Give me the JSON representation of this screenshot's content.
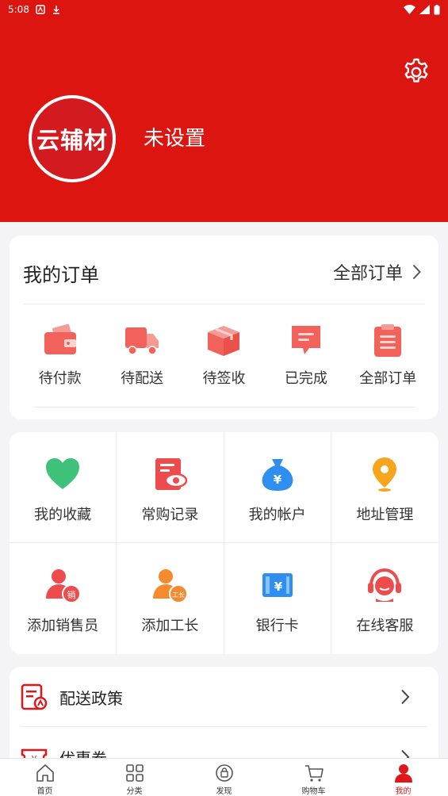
{
  "status_bar": {
    "time": "5:08"
  },
  "profile": {
    "avatar_text": "云辅材",
    "username": "未设置"
  },
  "orders": {
    "title": "我的订单",
    "all_label": "全部订单",
    "items": [
      {
        "label": "待付款",
        "icon": "wallet-icon"
      },
      {
        "label": "待配送",
        "icon": "truck-icon"
      },
      {
        "label": "待签收",
        "icon": "package-icon"
      },
      {
        "label": "已完成",
        "icon": "message-icon"
      },
      {
        "label": "全部订单",
        "icon": "clipboard-icon"
      }
    ]
  },
  "grid": {
    "items": [
      {
        "label": "我的收藏",
        "icon": "heart-icon"
      },
      {
        "label": "常购记录",
        "icon": "record-eye-icon"
      },
      {
        "label": "我的帐户",
        "icon": "money-bag-icon"
      },
      {
        "label": "地址管理",
        "icon": "location-pin-icon"
      },
      {
        "label": "添加销售员",
        "icon": "salesperson-icon",
        "badge": "销"
      },
      {
        "label": "添加工长",
        "icon": "foreman-icon",
        "badge": "工长"
      },
      {
        "label": "银行卡",
        "icon": "bank-card-icon"
      },
      {
        "label": "在线客服",
        "icon": "headset-icon"
      }
    ]
  },
  "list": {
    "items": [
      {
        "label": "配送政策",
        "icon": "delivery-policy-icon"
      },
      {
        "label": "优惠券",
        "icon": "coupon-icon"
      }
    ]
  },
  "bottom_nav": {
    "items": [
      {
        "label": "首页",
        "icon": "home-icon"
      },
      {
        "label": "分类",
        "icon": "category-icon"
      },
      {
        "label": "发现",
        "icon": "discover-icon"
      },
      {
        "label": "购物车",
        "icon": "cart-icon"
      },
      {
        "label": "我的",
        "icon": "user-icon",
        "active": true
      }
    ]
  },
  "colors": {
    "brand_red": "#dc1510",
    "accent_red": "#e0161b",
    "order_icon": "#f2625a",
    "heart_green": "#3ec27a",
    "bag_blue": "#2f8ff0",
    "pin_orange": "#f7a51c"
  }
}
